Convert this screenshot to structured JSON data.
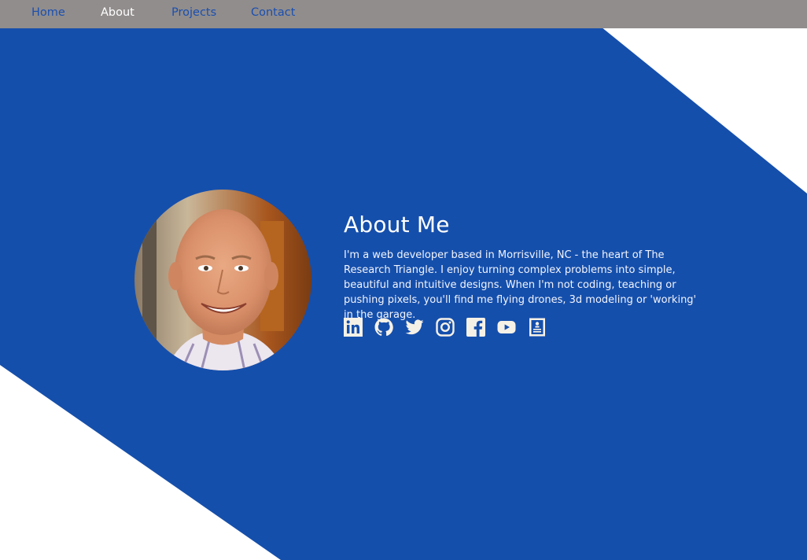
{
  "nav": {
    "items": [
      {
        "label": "Home",
        "active": false
      },
      {
        "label": "About",
        "active": true
      },
      {
        "label": "Projects",
        "active": false
      },
      {
        "label": "Contact",
        "active": false
      }
    ]
  },
  "about": {
    "title": "About Me",
    "description": "I'm a web developer based in Morrisville, NC - the heart of The Research Triangle. I enjoy turning complex problems into simple, beautiful and intuitive designs. When I'm not coding, teaching or pushing pixels, you'll find me flying drones, 3d modeling or 'working' in the garage."
  },
  "socials": [
    "linkedin-icon",
    "github-icon",
    "twitter-icon",
    "instagram-icon",
    "facebook-icon",
    "youtube-icon",
    "resume-icon"
  ],
  "colors": {
    "nav_bg": "#918d8c",
    "nav_link": "#1a4fb0",
    "nav_active": "#ffffff",
    "hero_blue": "#154fac",
    "icon": "#f6f1e6"
  }
}
